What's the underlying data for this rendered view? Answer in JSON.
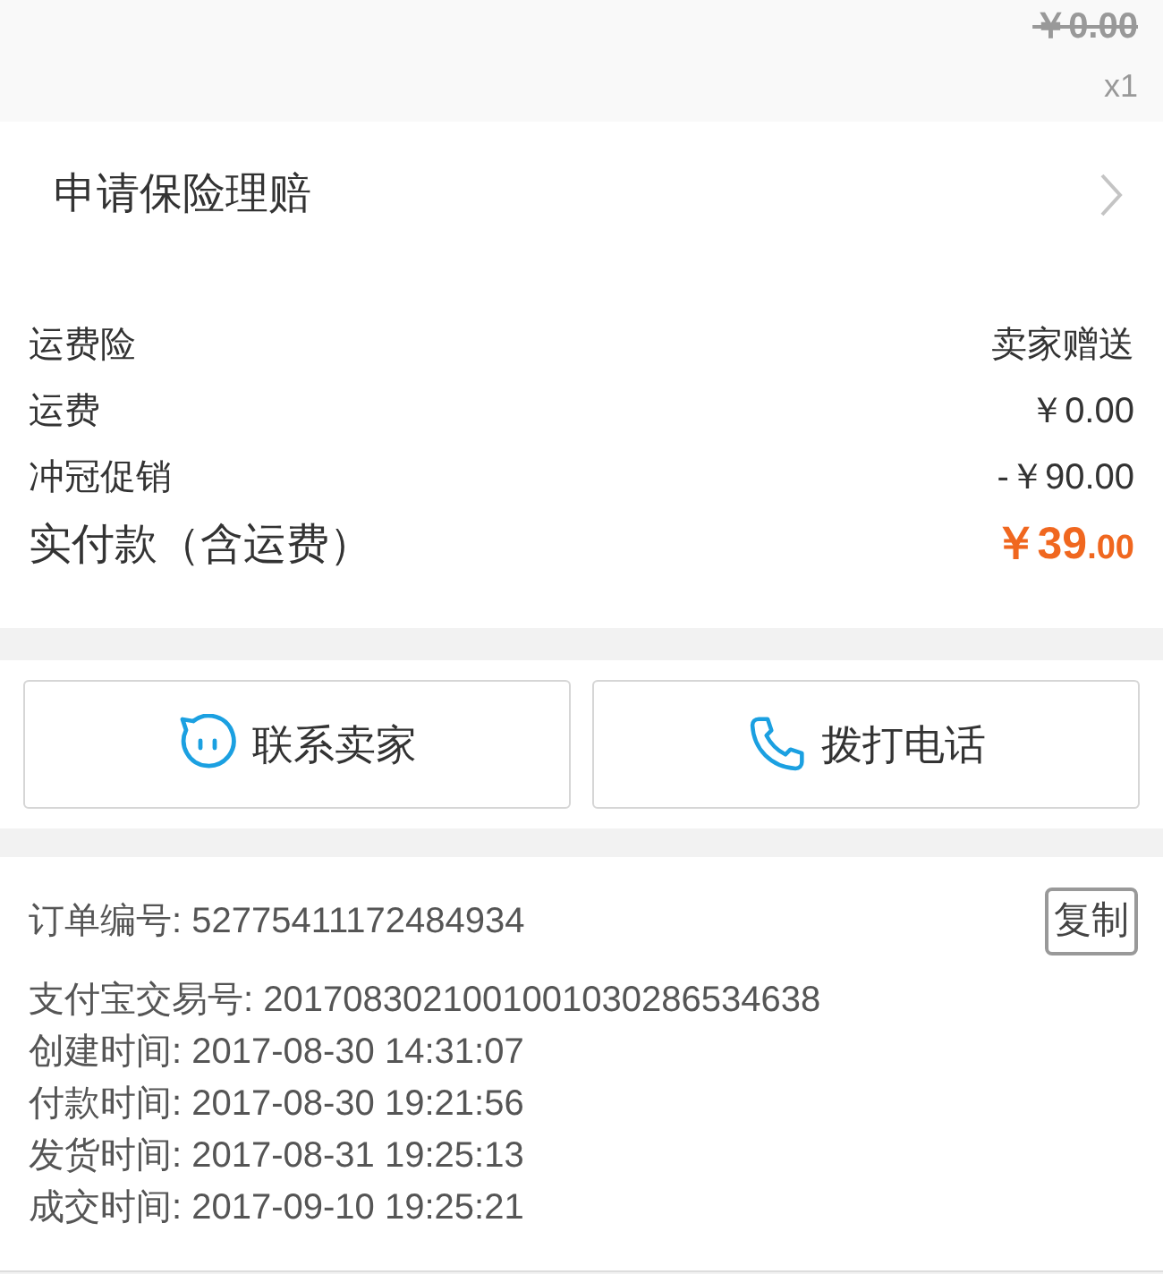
{
  "item": {
    "original_price": "￥0.00",
    "quantity": "x1"
  },
  "claim": {
    "label": "申请保险理赔"
  },
  "fees": [
    {
      "label": "运费险",
      "value": "卖家赠送"
    },
    {
      "label": "运费",
      "value": "￥0.00"
    },
    {
      "label": "冲冠促销",
      "value": "-￥90.00"
    }
  ],
  "total": {
    "label": "实付款（含运费）",
    "amount": "￥39",
    "decimal": ".00"
  },
  "buttons": [
    {
      "kind": "chat",
      "label": "联系卖家"
    },
    {
      "kind": "phone",
      "label": "拨打电话"
    }
  ],
  "order": {
    "number_label": "订单编号:",
    "number": "52775411172484934",
    "copy_button": "复制",
    "details": [
      {
        "label": "支付宝交易号:",
        "value": "2017083021001001030286534638"
      },
      {
        "label": "创建时间:",
        "value": "2017-08-30 14:31:07"
      },
      {
        "label": "付款时间:",
        "value": "2017-08-30 19:21:56"
      },
      {
        "label": "发货时间:",
        "value": "2017-08-31 19:25:13"
      },
      {
        "label": "成交时间:",
        "value": "2017-09-10 19:25:21"
      }
    ]
  }
}
